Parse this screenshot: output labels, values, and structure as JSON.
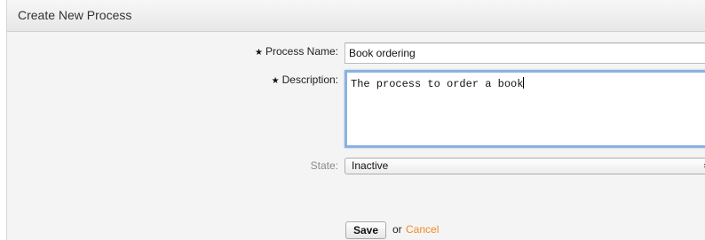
{
  "panel": {
    "title": "Create New Process"
  },
  "form": {
    "required_marker": "★",
    "process_name": {
      "label": "Process Name:",
      "value": "Book ordering"
    },
    "description": {
      "label": "Description:",
      "value": "The process to order a book"
    },
    "state": {
      "label": "State:",
      "selected": "Inactive",
      "arrows": "⬍"
    },
    "actions": {
      "save_label": "Save",
      "or_text": "or",
      "cancel_label": "Cancel"
    }
  },
  "colors": {
    "cancel_link": "#f58a25",
    "focus_border": "#8bb2de"
  }
}
